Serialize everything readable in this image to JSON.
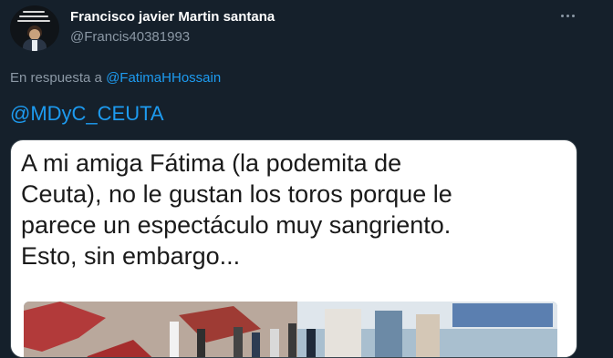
{
  "tweet": {
    "display_name": "Francisco javier Martin santana",
    "handle": "@Francis40381993",
    "reply_prefix": "En respuesta a",
    "reply_handle": "@FatimaHHossain",
    "text": "@MDyC_CEUTA",
    "more_icon": "more-horizontal-icon"
  },
  "media": {
    "image_text": [
      "A mi amiga Fátima (la podemita de",
      "Ceuta), no le gustan los toros porque le",
      "parece un espectáculo muy sangriento.",
      "Esto, sin embargo..."
    ]
  },
  "colors": {
    "background": "#15202b",
    "primary_text": "#ffffff",
    "secondary_text": "#8b98a5",
    "link": "#1d9bf0",
    "media_background": "#ffffff"
  }
}
